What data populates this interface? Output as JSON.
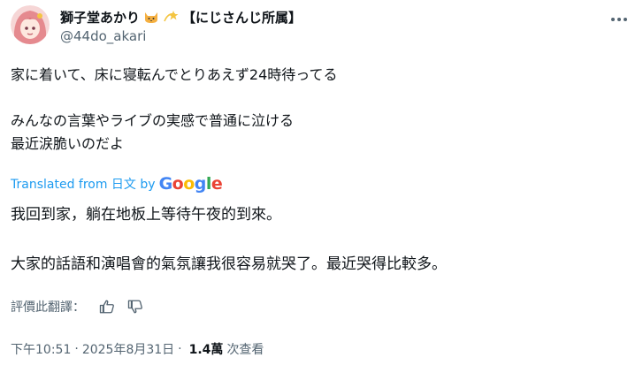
{
  "author": {
    "display_name": "獅子堂あかり",
    "affiliation": "【にじさんじ所属】",
    "handle": "@44do_akari",
    "avatar_icon": "avatar-image",
    "emoji_icons": [
      "cat-face-icon",
      "dizzy-star-icon"
    ]
  },
  "tweet": {
    "original_text": "家に着いて、床に寝転んでとりあえず24時待ってる\n\nみんなの言葉やライブの実感で普通に泣ける\n最近涙脆いのだよ",
    "translated_from_label": "Translated from 日文 by",
    "translator_logo": "Google",
    "translation_text": "我回到家，躺在地板上等待午夜的到來。\n\n大家的話語和演唱會的氣氛讓我很容易就哭了。最近哭得比較多。",
    "rate_label": "評價此翻譯：",
    "time": "下午10:51",
    "date": "2025年8月31日",
    "sep": "·",
    "views_count": "1.4萬",
    "views_label": "次查看"
  },
  "colors": {
    "link_blue": "#1d9bf0",
    "secondary_text": "#536471",
    "primary_text": "#0f1419"
  }
}
